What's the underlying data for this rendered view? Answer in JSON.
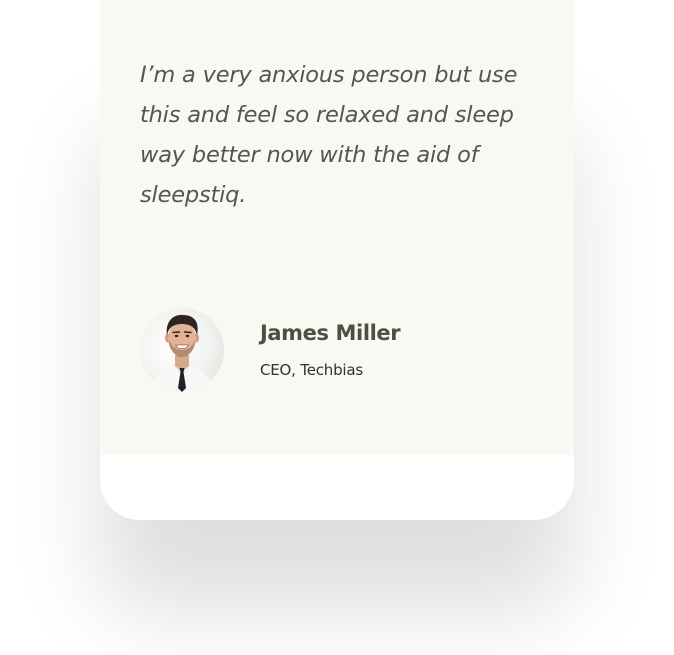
{
  "testimonial": {
    "quote": "I’m a very anxious person but use this and feel so relaxed and sleep way better now with the aid of sleepstiq.",
    "author": {
      "name": "James Miller",
      "role": "CEO, Techbias",
      "avatar_icon": "person-photo"
    }
  },
  "colors": {
    "card_background": "#faf8f2",
    "quote_text": "#55574f",
    "name_text": "#4d5040",
    "role_text": "#2f3136"
  }
}
